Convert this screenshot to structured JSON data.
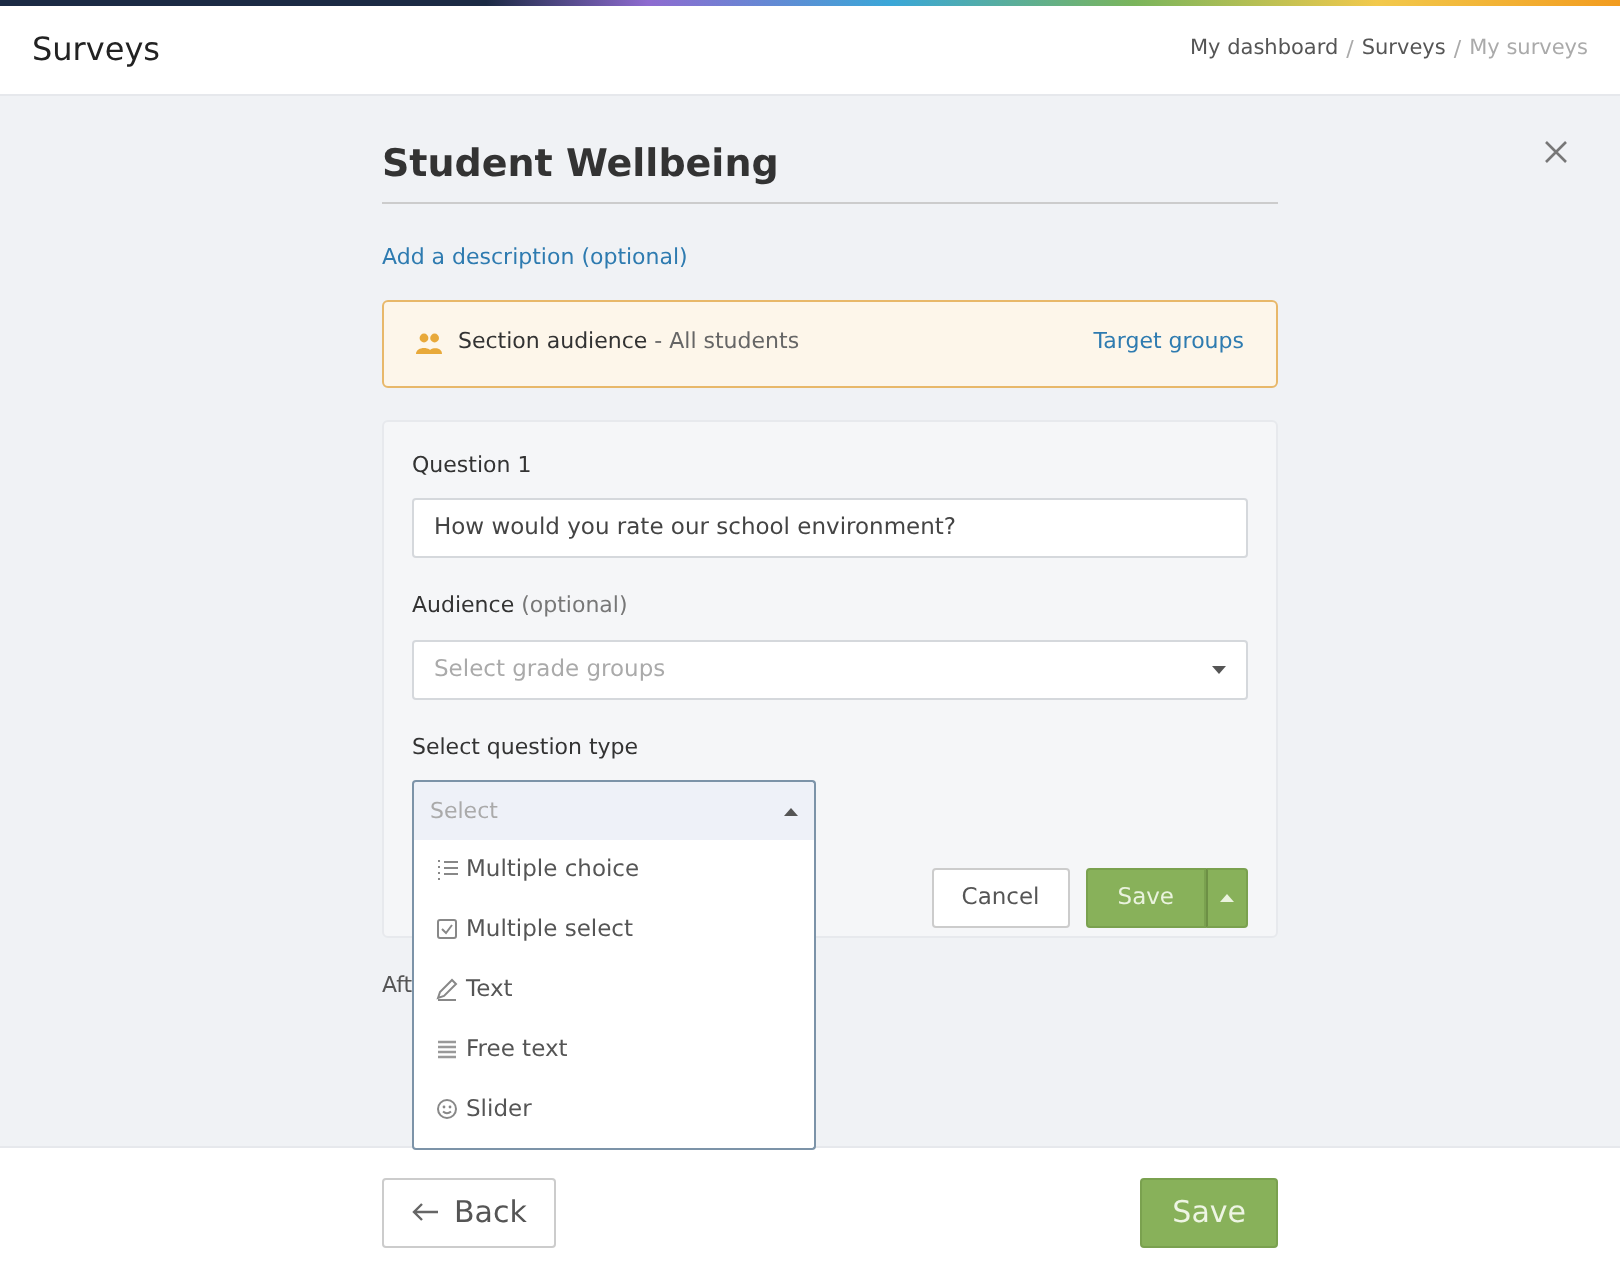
{
  "header": {
    "title": "Surveys",
    "breadcrumb_separator": "/",
    "breadcrumbs": [
      {
        "label": "My dashboard",
        "current": false
      },
      {
        "label": "Surveys",
        "current": false
      },
      {
        "label": "My surveys",
        "current": true
      }
    ]
  },
  "survey": {
    "title": "Student Wellbeing",
    "description_link": "Add a description (optional)"
  },
  "section_audience": {
    "label": "Section audience",
    "separator": " - ",
    "value": "All students",
    "link": "Target groups"
  },
  "question": {
    "label": "Question 1",
    "value": "How would you rate our school environment?",
    "audience_label": "Audience",
    "audience_hint": "(optional)",
    "audience_placeholder": "Select grade groups",
    "type_label": "Select question type",
    "type_placeholder": "Select",
    "type_expanded": true,
    "type_options": [
      {
        "kind": "list",
        "label": "Multiple choice"
      },
      {
        "kind": "checkbox",
        "label": "Multiple select"
      },
      {
        "kind": "pencil",
        "label": "Text"
      },
      {
        "kind": "lines",
        "label": "Free text"
      },
      {
        "kind": "smiley",
        "label": "Slider"
      }
    ],
    "cancel": "Cancel",
    "save": "Save"
  },
  "after_text": "Aft",
  "footer": {
    "back": "Back",
    "save": "Save"
  }
}
